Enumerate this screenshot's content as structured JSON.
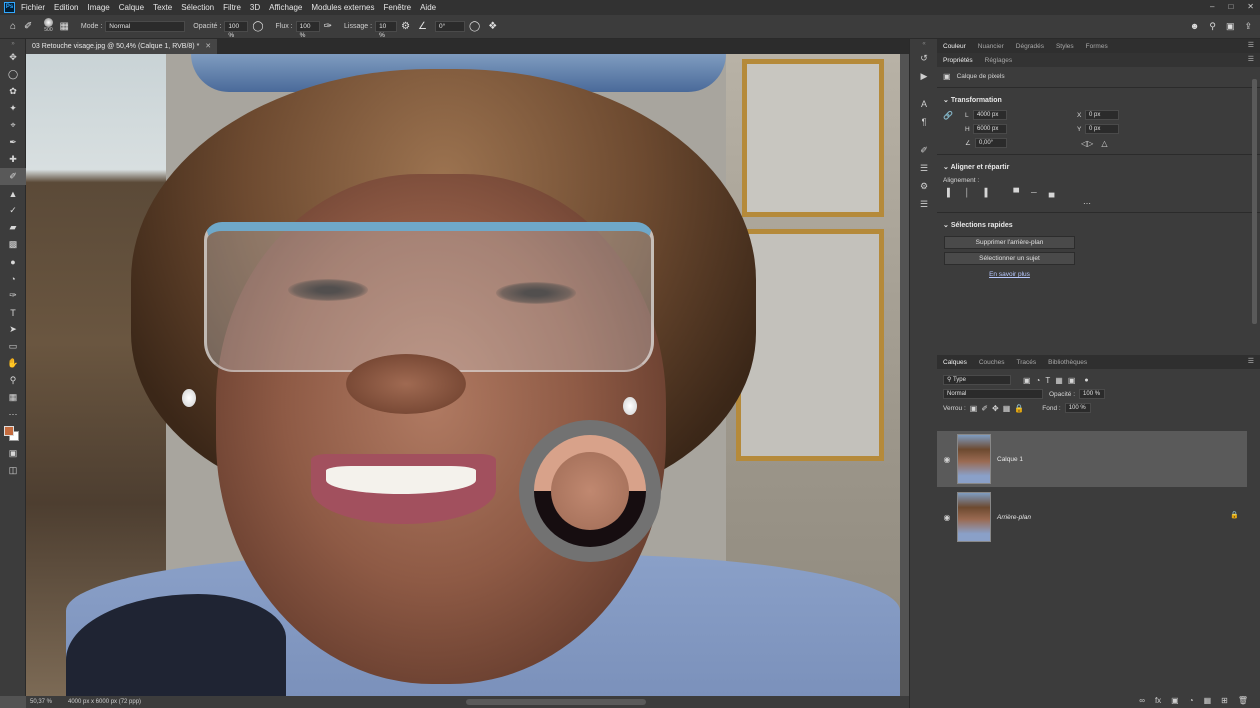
{
  "app": {
    "logo": "Ps"
  },
  "menu": [
    "Fichier",
    "Edition",
    "Image",
    "Calque",
    "Texte",
    "Sélection",
    "Filtre",
    "3D",
    "Affichage",
    "Modules externes",
    "Fenêtre",
    "Aide"
  ],
  "options": {
    "brush_size": "500",
    "mode_label": "Mode :",
    "mode_value": "Normal",
    "opacity_label": "Opacité :",
    "opacity_value": "100 %",
    "flow_label": "Flux :",
    "flow_value": "100 %",
    "smoothing_label": "Lissage :",
    "smoothing_value": "10 %",
    "angle_value": "0°"
  },
  "document": {
    "tab_title": "03 Retouche visage.jpg @ 50,4% (Calque 1, RVB/8) *"
  },
  "status": {
    "zoom": "50,37 %",
    "info": "4000 px x 6000 px (72 ppp)"
  },
  "colors": {
    "foreground": "#c46b3e",
    "background": "#ffffff"
  },
  "panel_top": {
    "tabs": [
      "Couleur",
      "Nuancier",
      "Dégradés",
      "Styles",
      "Formes"
    ],
    "subtabs": [
      "Propriétés",
      "Réglages"
    ],
    "layer_kind": "Calque de pixels",
    "transform_title": "Transformation",
    "w_label": "L",
    "w_value": "4000 px",
    "h_label": "H",
    "h_value": "6000 px",
    "x_label": "X",
    "x_value": "0 px",
    "y_label": "Y",
    "y_value": "0 px",
    "angle_value": "0,00°",
    "align_title": "Aligner et répartir",
    "align_label": "Alignement :",
    "quick_title": "Sélections rapides",
    "btn_remove_bg": "Supprimer l'arrière-plan",
    "btn_select_subject": "Sélectionner un sujet",
    "learn_more": "En savoir plus"
  },
  "layers_panel": {
    "tabs": [
      "Calques",
      "Couches",
      "Tracés",
      "Bibliothèques"
    ],
    "filter_value": "Type",
    "blend_value": "Normal",
    "opacity_label": "Opacité :",
    "opacity_value": "100 %",
    "lock_label": "Verrou :",
    "fill_label": "Fond :",
    "fill_value": "100 %",
    "layers": [
      {
        "name": "Calque 1",
        "selected": true
      },
      {
        "name": "Arrière-plan",
        "selected": false
      }
    ]
  }
}
